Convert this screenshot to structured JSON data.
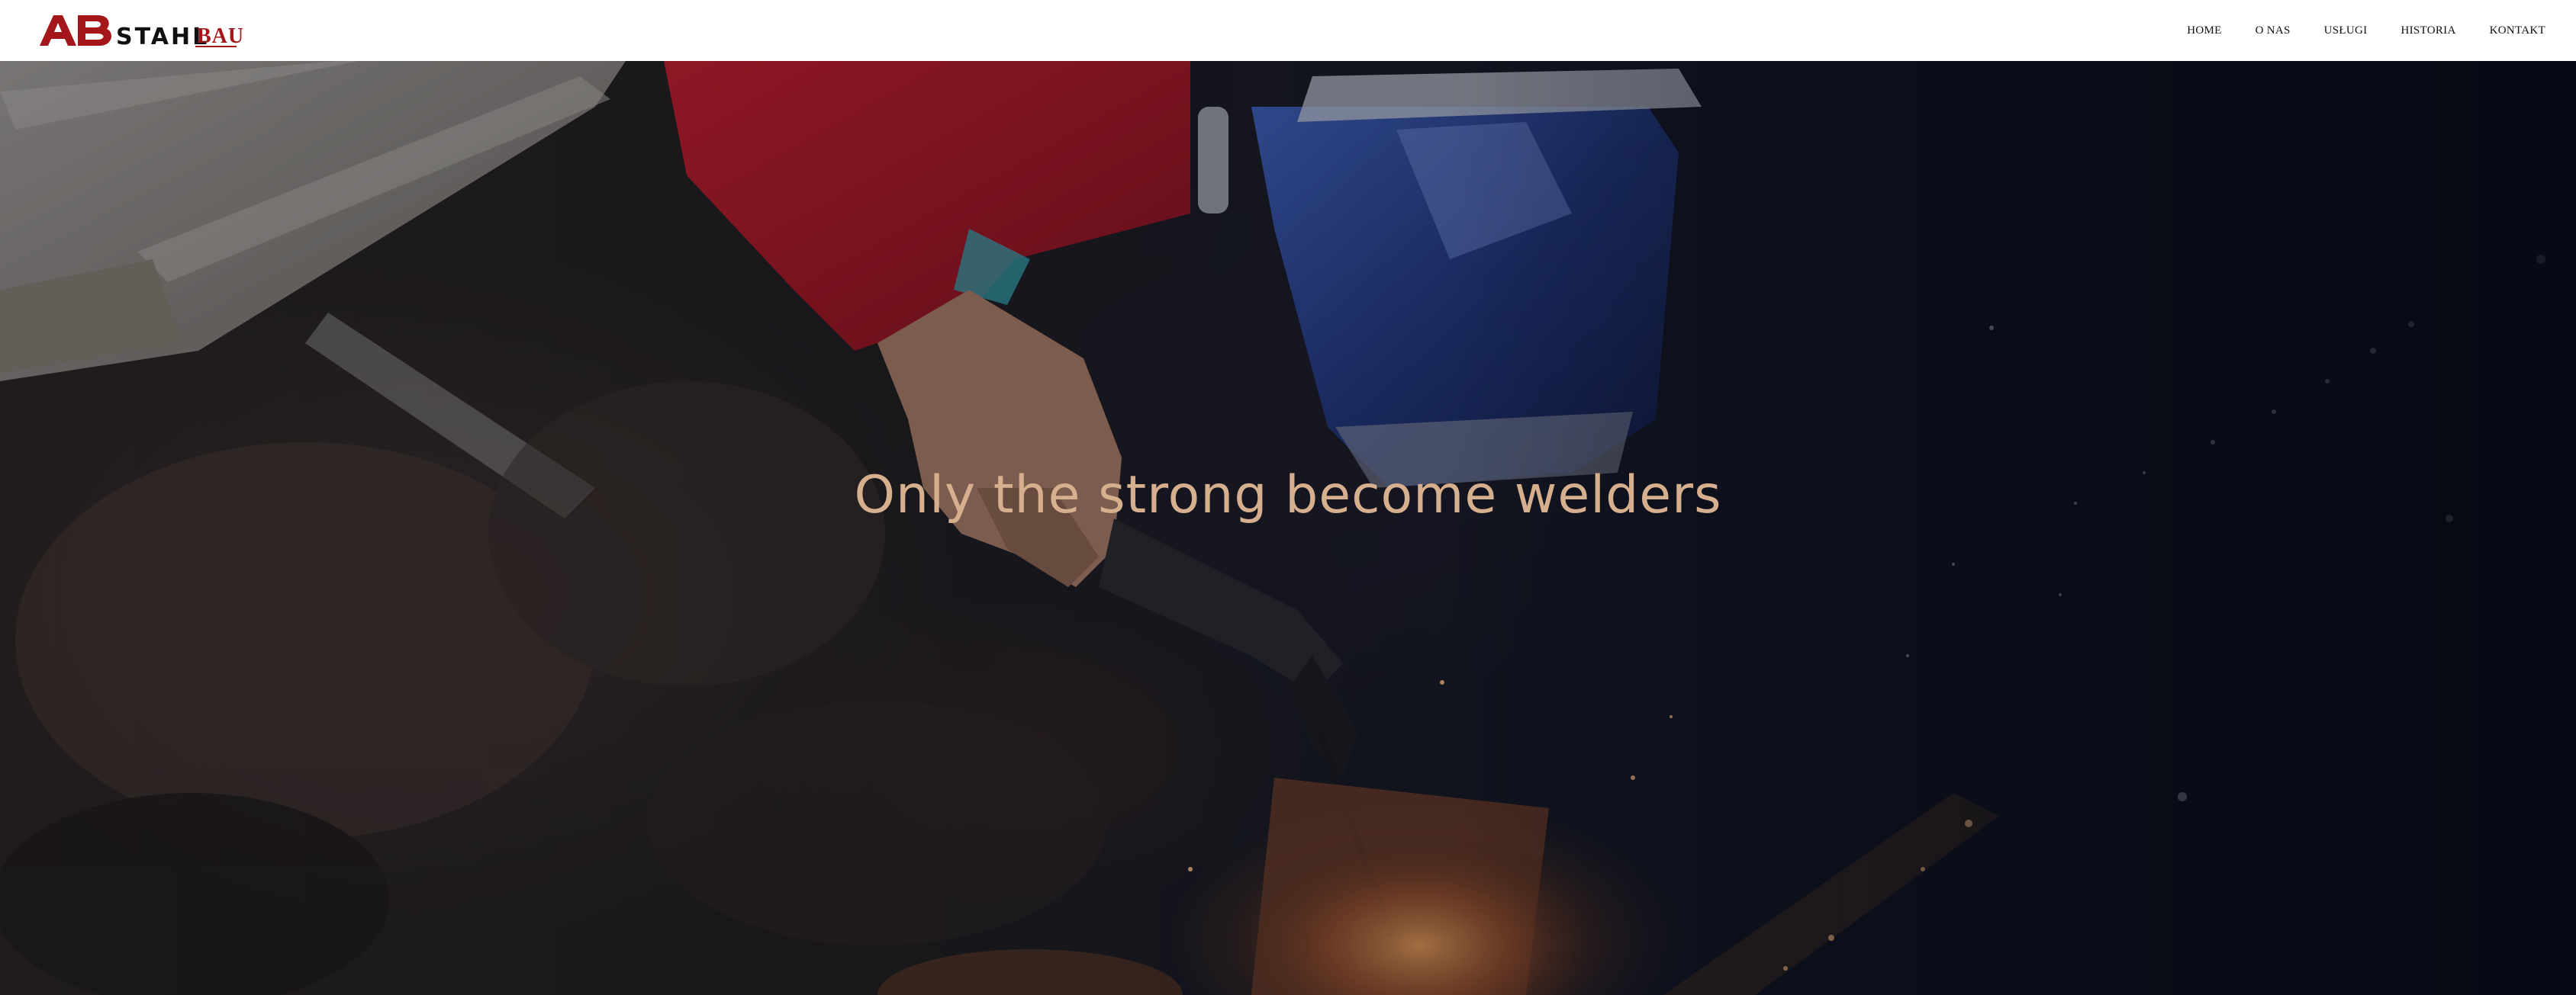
{
  "header": {
    "logo": {
      "mark_text": "AB",
      "word_stahl": "STAHL",
      "word_bau": "BAU",
      "brand_color": "#a5161b"
    },
    "nav": [
      {
        "label": "HOME"
      },
      {
        "label": "O NAS"
      },
      {
        "label": "USŁUGI"
      },
      {
        "label": "HISTORIA"
      },
      {
        "label": "KONTAKT"
      }
    ]
  },
  "hero": {
    "title": "Only the strong become welders",
    "title_color": "#d6b08e",
    "image_subject": "welder-with-blue-helmet-and-red-sleeve"
  }
}
